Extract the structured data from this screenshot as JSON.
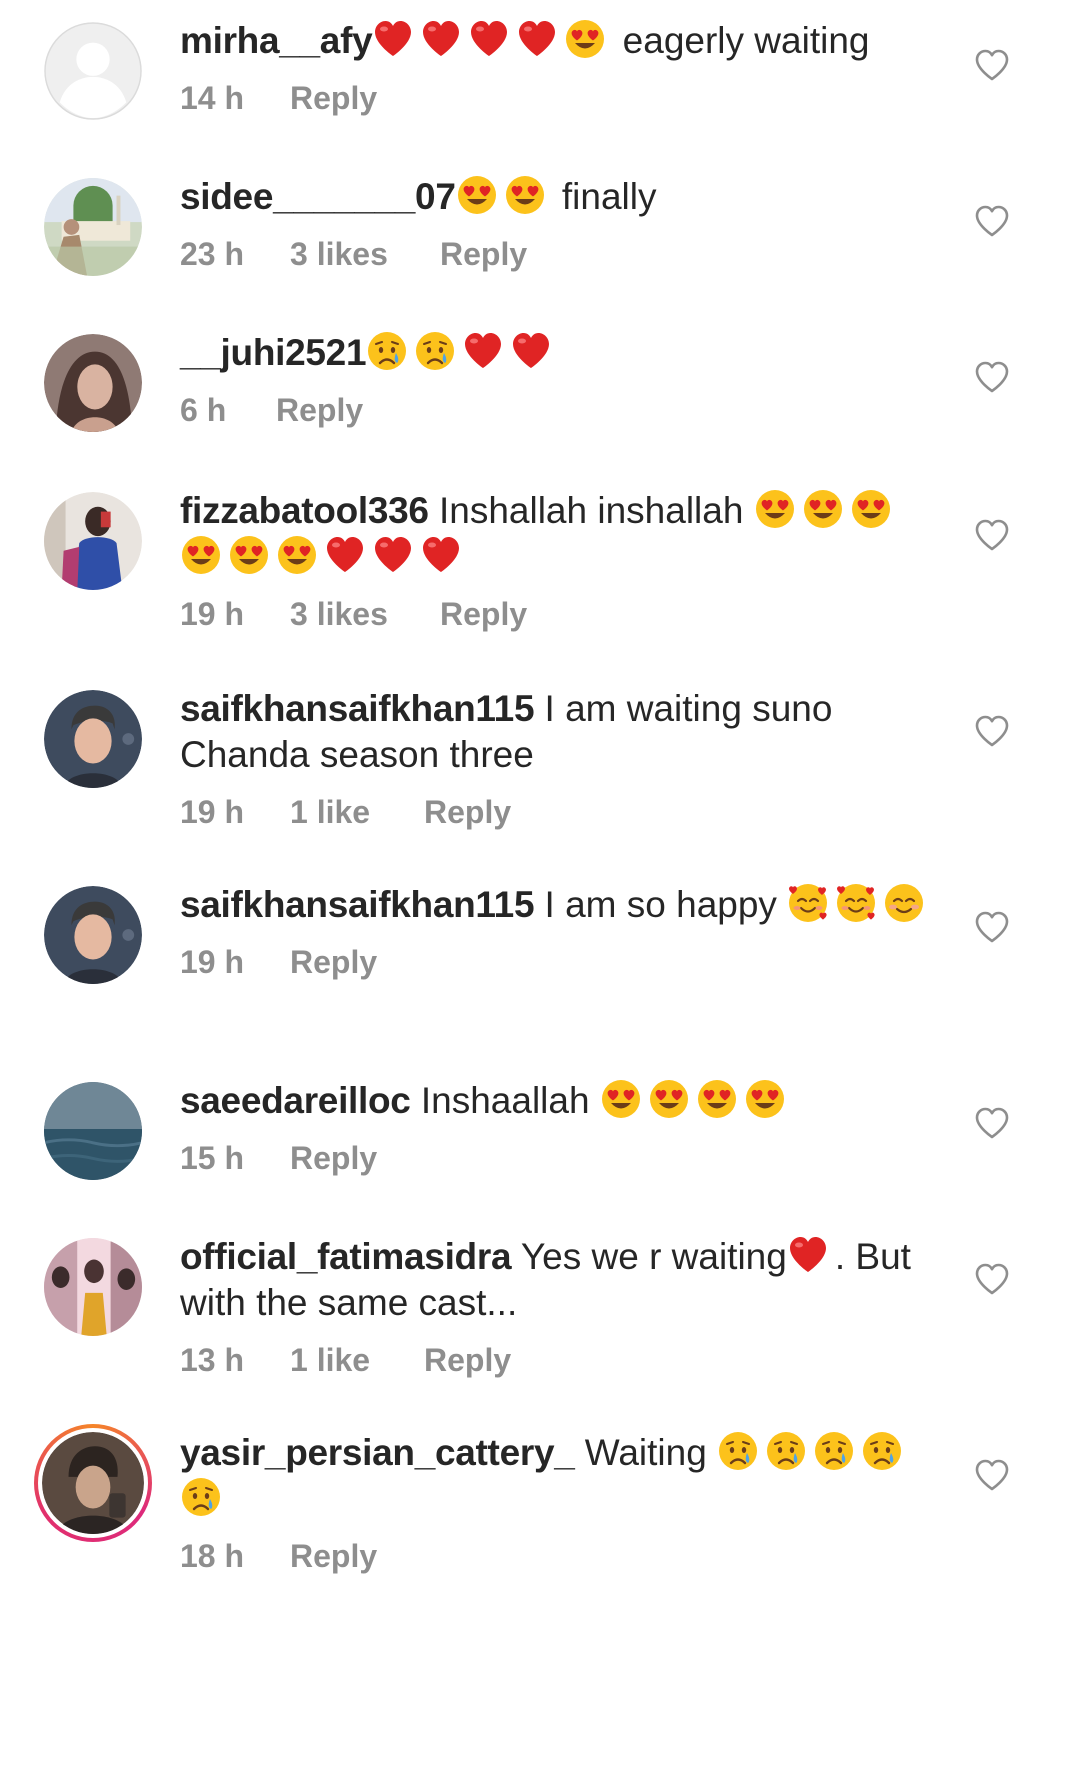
{
  "comments": [
    {
      "username": "mirha__afy",
      "before": "",
      "emojis": [
        "heart",
        "heart",
        "heart",
        "heart",
        "heart-eyes"
      ],
      "after": " eagerly waiting",
      "time": "14 h",
      "likes": "",
      "reply": "Reply"
    },
    {
      "username": "sidee_______07",
      "before": "",
      "emojis": [
        "heart-eyes",
        "heart-eyes"
      ],
      "after": " finally",
      "time": "23 h",
      "likes": "3 likes",
      "reply": "Reply"
    },
    {
      "username": "__juhi2521",
      "before": "",
      "emojis": [
        "crying",
        "crying",
        "heart",
        "heart"
      ],
      "after": "",
      "time": "6 h",
      "likes": "",
      "reply": "Reply"
    },
    {
      "username": "fizzabatool336",
      "before": " Inshallah inshallah ",
      "emojis": [
        "heart-eyes",
        "heart-eyes",
        "heart-eyes",
        "heart-eyes",
        "heart-eyes",
        "heart-eyes",
        "heart",
        "heart",
        "heart"
      ],
      "after": "",
      "time": "19 h",
      "likes": "3 likes",
      "reply": "Reply"
    },
    {
      "username": "saifkhansaifkhan115",
      "before": " I am waiting suno Chanda season three",
      "emojis": [],
      "after": "",
      "time": "19 h",
      "likes": "1 like",
      "reply": "Reply"
    },
    {
      "username": "saifkhansaifkhan115",
      "before": " I am so happy ",
      "emojis": [
        "smiling-hearts",
        "smiling-hearts",
        "smiling-blush"
      ],
      "after": "",
      "time": "19 h",
      "likes": "",
      "reply": "Reply"
    },
    {
      "username": "saeedareilloc",
      "before": " Inshaallah ",
      "emojis": [
        "heart-eyes",
        "heart-eyes",
        "heart-eyes",
        "heart-eyes"
      ],
      "after": "",
      "time": "15 h",
      "likes": "",
      "reply": "Reply"
    },
    {
      "username": "official_fatimasidra",
      "before": " Yes we r waiting",
      "emojis": [
        "heart"
      ],
      "after": ". But with the same cast...",
      "time": "13 h",
      "likes": "1 like",
      "reply": "Reply"
    },
    {
      "username": "yasir_persian_cattery_",
      "before": " Waiting ",
      "emojis": [
        "crying",
        "crying",
        "crying",
        "crying",
        "crying"
      ],
      "after": "",
      "time": "18 h",
      "likes": "",
      "reply": "Reply"
    }
  ],
  "colors": {
    "text": "#262626",
    "meta": "#8e8e8e",
    "heart_outline": "#8e8e8e",
    "emoji_heart": "#e02424",
    "emoji_face": "#fcc21b",
    "story_ring": "#dd2a7b"
  },
  "icons": {
    "like_button": "heart-outline-icon",
    "default_avatar": "default-avatar-icon"
  }
}
